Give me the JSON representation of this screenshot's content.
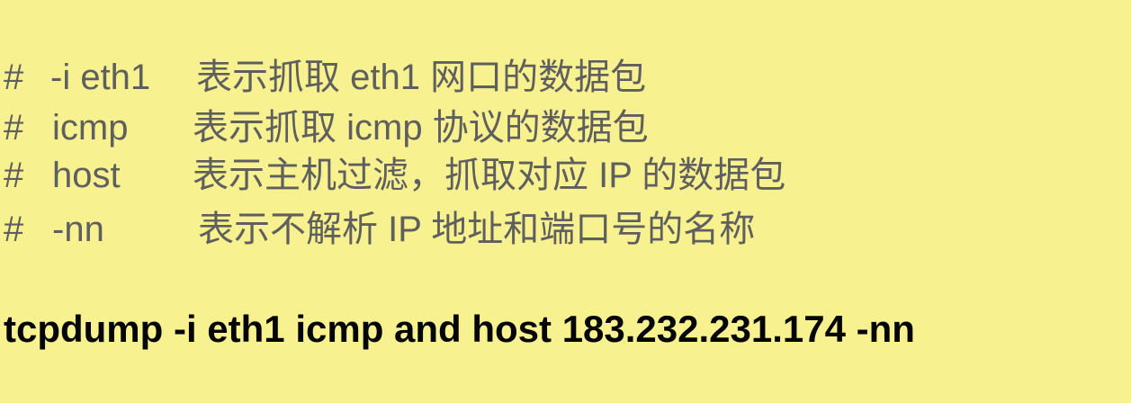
{
  "comments": [
    {
      "hash": "#",
      "flag": "-i eth1",
      "description": "表示抓取 eth1 网口的数据包"
    },
    {
      "hash": "#",
      "flag": "icmp",
      "description": "表示抓取 icmp 协议的数据包"
    },
    {
      "hash": "#",
      "flag": "host",
      "description": "表示主机过滤，抓取对应 IP 的数据包"
    },
    {
      "hash": "#",
      "flag": "-nn",
      "description": "表示不解析 IP 地址和端口号的名称"
    }
  ],
  "command": "tcpdump -i eth1 icmp and host 183.232.231.174 -nn",
  "colors": {
    "background": "#f7f18f",
    "comment_text": "#5f5f5f",
    "command_text": "#050505"
  }
}
